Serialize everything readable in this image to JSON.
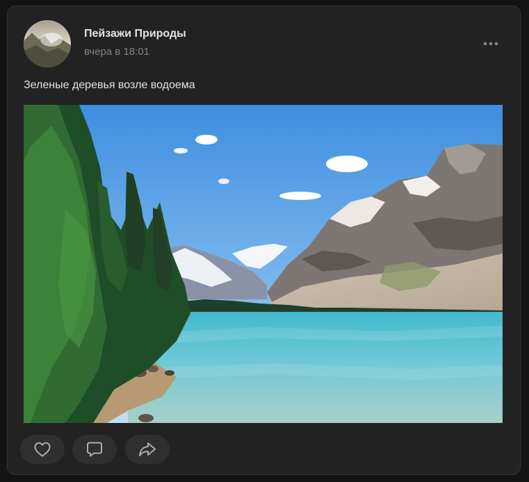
{
  "post": {
    "author_name": "Пейзажи Природы",
    "time": "вчера в 18:01",
    "text": "Зеленые деревья возле водоема",
    "photo_description": "mountain-lake-photo"
  },
  "icons": {
    "avatar": "avatar-landscape-icon",
    "more": "more-dots-icon",
    "like": "heart-icon",
    "comment": "comment-icon",
    "share": "share-arrow-icon"
  },
  "colors": {
    "background": "#141414",
    "card": "#222222",
    "text_primary": "#e1e3e6",
    "text_secondary": "#828282",
    "button_bg": "#2f2f2f",
    "icon": "#aaaeb3"
  }
}
